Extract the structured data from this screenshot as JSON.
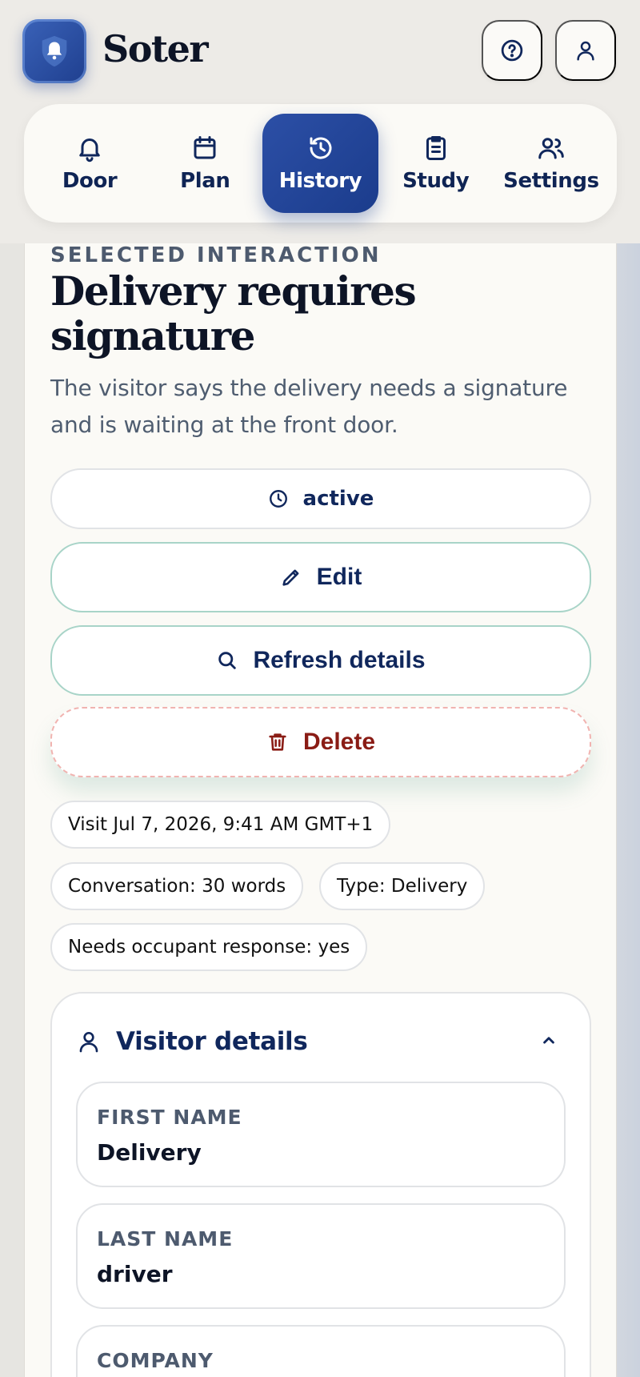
{
  "app": {
    "title": "Soter",
    "logo_icon": "bell-shield-icon"
  },
  "header": {
    "help_icon": "help-circle-icon",
    "profile_icon": "user-icon"
  },
  "nav": {
    "items": [
      {
        "label": "Door",
        "icon": "bell-icon"
      },
      {
        "label": "Plan",
        "icon": "calendar-icon"
      },
      {
        "label": "History",
        "icon": "history-icon",
        "active": true
      },
      {
        "label": "Study",
        "icon": "clipboard-icon"
      },
      {
        "label": "Settings",
        "icon": "users-icon"
      }
    ],
    "active_color": "#1f3f8f"
  },
  "interaction": {
    "eyebrow": "SELECTED INTERACTION",
    "title": "Delivery requires signature",
    "description": "The visitor says the delivery needs a signature and is waiting at the front door.",
    "status": "active"
  },
  "actions": {
    "edit_label": "Edit",
    "refresh_label": "Refresh details",
    "delete_label": "Delete",
    "delete_color": "#8a1c15"
  },
  "meta": {
    "visit": "Visit Jul 7, 2026, 9:41 AM GMT+1",
    "conversation": "Conversation: 30 words",
    "type": "Type: Delivery",
    "needs_response": "Needs occupant response: yes"
  },
  "visitor_details": {
    "title": "Visitor details",
    "expanded": true,
    "fields": [
      {
        "label": "FIRST NAME",
        "value": "Delivery"
      },
      {
        "label": "LAST NAME",
        "value": "driver"
      },
      {
        "label": "COMPANY",
        "value": ""
      }
    ]
  }
}
